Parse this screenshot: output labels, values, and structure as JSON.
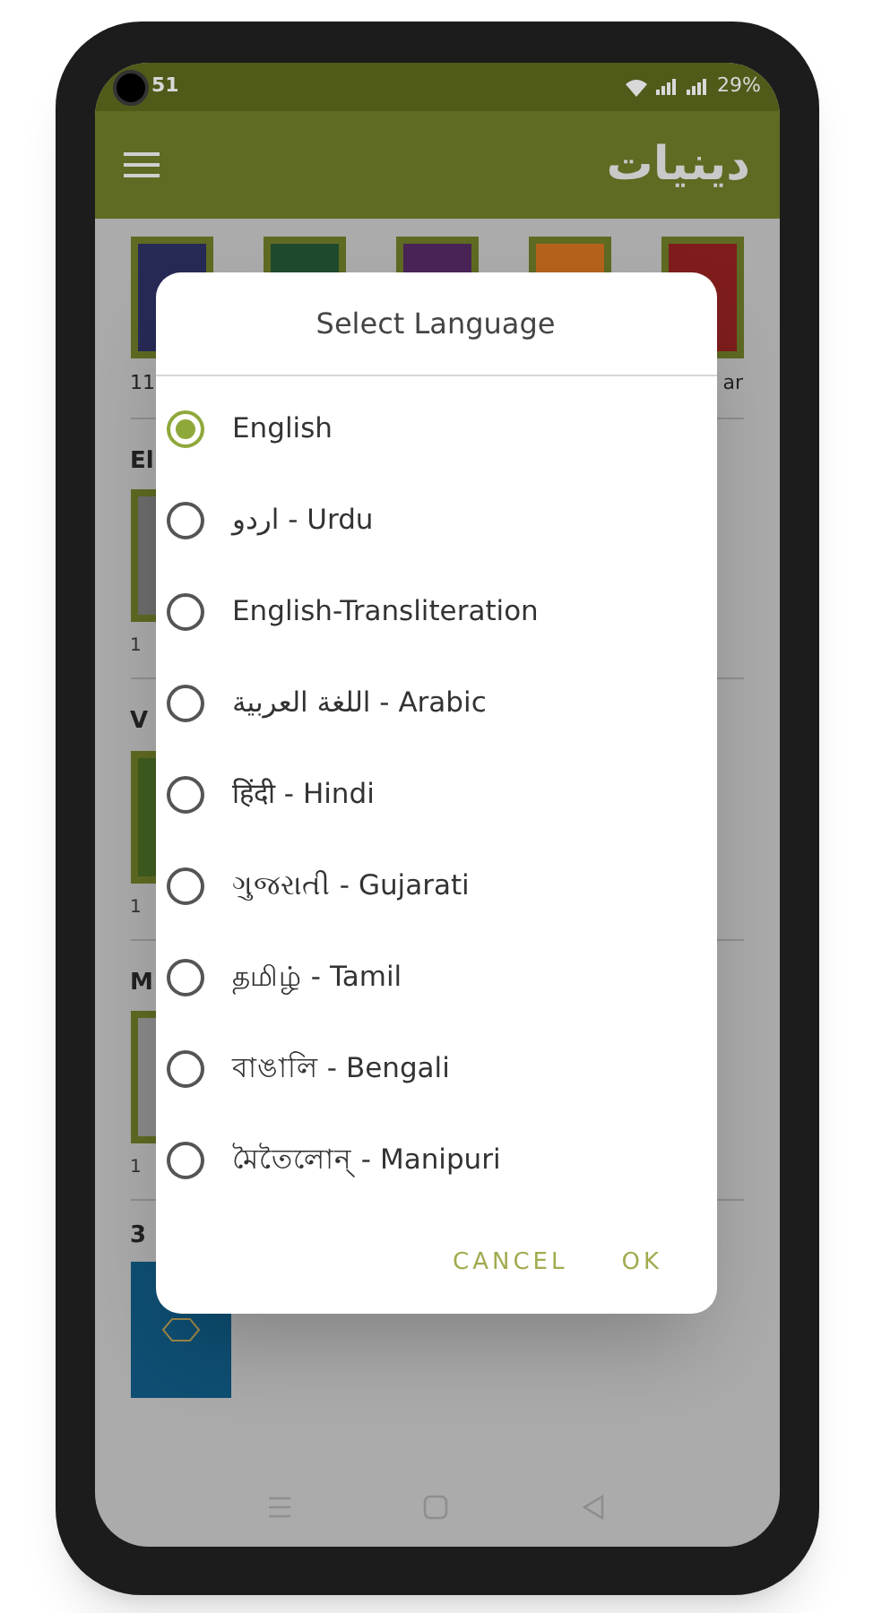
{
  "status_bar": {
    "time": "51",
    "battery": "29%"
  },
  "app_bar": {
    "logo": "دينيات"
  },
  "background": {
    "book_row": [
      {
        "color": "#262a55"
      },
      {
        "color": "#1f4a2e"
      },
      {
        "color": "#4a2457"
      },
      {
        "color": "#b5631c"
      },
      {
        "color": "#7f1d1d"
      }
    ],
    "book_row_captions": [
      "11",
      "ar"
    ],
    "sections": [
      {
        "title": "El",
        "color": "#6d6d6d",
        "caption": "1"
      },
      {
        "title": "V",
        "color": "#3f5d1f",
        "caption": "1"
      },
      {
        "title": "M",
        "color": "#8a8a8a",
        "caption": "1"
      }
    ],
    "last_section": {
      "title": "3"
    }
  },
  "dialog": {
    "title": "Select Language",
    "options": [
      {
        "label": "English",
        "selected": true
      },
      {
        "label": "اردو - Urdu",
        "selected": false
      },
      {
        "label": "English-Transliteration",
        "selected": false
      },
      {
        "label": "اللغة العربية - Arabic",
        "selected": false
      },
      {
        "label": "हिंदी - Hindi",
        "selected": false
      },
      {
        "label": "ગુજરાતી - Gujarati",
        "selected": false
      },
      {
        "label": "தமிழ் - Tamil",
        "selected": false
      },
      {
        "label": "বাঙালি - Bengali",
        "selected": false
      },
      {
        "label": "মৈতৈলোন্ - Manipuri",
        "selected": false
      }
    ],
    "buttons": [
      "CANCEL",
      "OK"
    ]
  }
}
